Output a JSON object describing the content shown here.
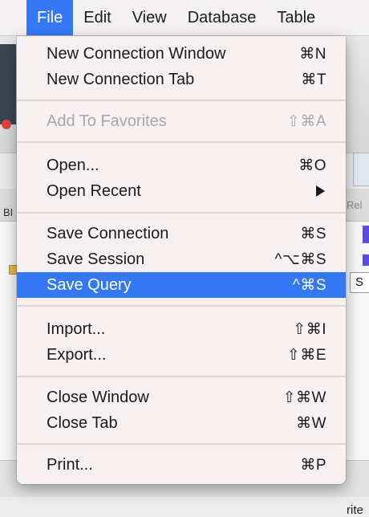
{
  "menubar": {
    "items": [
      "File",
      "Edit",
      "View",
      "Database",
      "Table"
    ]
  },
  "background": {
    "rel_label": "Rel",
    "br_label": "BI",
    "s_label": "S",
    "rite_label": "rite"
  },
  "file_menu": {
    "new_connection_window": {
      "label": "New Connection Window",
      "shortcut": "⌘N"
    },
    "new_connection_tab": {
      "label": "New Connection Tab",
      "shortcut": "⌘T"
    },
    "add_to_favorites": {
      "label": "Add To Favorites",
      "shortcut": "⇧⌘A",
      "enabled": false
    },
    "open": {
      "label": "Open...",
      "shortcut": "⌘O"
    },
    "open_recent": {
      "label": "Open Recent",
      "submenu": true
    },
    "save_connection": {
      "label": "Save Connection",
      "shortcut": "⌘S"
    },
    "save_session": {
      "label": "Save Session",
      "shortcut": "^⌥⌘S"
    },
    "save_query": {
      "label": "Save Query",
      "shortcut": "^⌘S",
      "highlighted": true
    },
    "import": {
      "label": "Import...",
      "shortcut": "⇧⌘I"
    },
    "export": {
      "label": "Export...",
      "shortcut": "⇧⌘E"
    },
    "close_window": {
      "label": "Close Window",
      "shortcut": "⇧⌘W"
    },
    "close_tab": {
      "label": "Close Tab",
      "shortcut": "⌘W"
    },
    "print": {
      "label": "Print...",
      "shortcut": "⌘P"
    }
  },
  "colors": {
    "highlight": "#3478f6",
    "disabled_text": "#a8a6a7",
    "menu_background": "#f7f1f2"
  }
}
